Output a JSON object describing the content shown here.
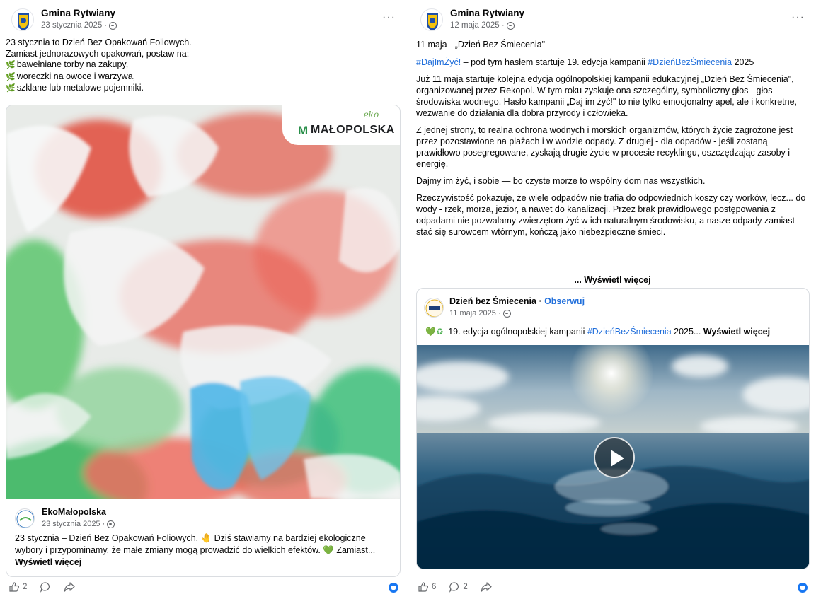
{
  "left_post": {
    "page_name": "Gmina Rytwiany",
    "date": "23 stycznia 2025 ·",
    "more": "···",
    "lines": [
      "23 stycznia to Dzień Bez Opakowań Foliowych.",
      "Zamiast jednorazowych opakowań, postaw na:"
    ],
    "bullets": [
      "bawełniane torby na zakupy,",
      "woreczki na owoce i warzywa,",
      "szklane lub metalowe pojemniki."
    ],
    "image_logo": {
      "eko": "– eko –",
      "brand": "MAŁOPOLSKA"
    },
    "shared": {
      "author": "EkoMałopolska",
      "date": "23 stycznia 2025 ·",
      "text": "23 stycznia – Dzień Bez Opakowań Foliowych. 🤚 Dziś stawiamy na bardziej ekologiczne wybory i przypominamy, że małe zmiany mogą prowadzić do wielkich efektów. 💚 Zamiast...",
      "see_more": "Wyświetl więcej"
    },
    "actions": {
      "likes": "2"
    }
  },
  "right_post": {
    "page_name": "Gmina Rytwiany",
    "date": "12 maja 2025 ·",
    "more": "···",
    "intro": "11 maja - „Dzień Bez Śmiecenia\"",
    "hashtag_line": {
      "tag1": "#DajImŻyć!",
      "middle": " – pod tym hasłem startuje 19. edycja kampanii ",
      "tag2": "#DzieńBezŚmiecenia",
      "end": " 2025"
    },
    "paragraphs": [
      "Już 11 maja startuje kolejna edycja ogólnopolskiej kampanii edukacyjnej „Dzień Bez Śmiecenia\", organizowanej przez Rekopol. W tym roku zyskuje ona szczególny, symboliczny głos - głos środowiska wodnego. Hasło kampanii „Daj im żyć!\" to nie tylko emocjonalny apel, ale i konkretne, wezwanie do działania dla dobra przyrody i człowieka.",
      "Z jednej strony, to realna ochrona wodnych i morskich organizmów, których życie zagrożone jest przez pozostawione na plażach i w wodzie odpady. Z drugiej - dla odpadów - jeśli zostaną prawidłowo posegregowane, zyskają drugie życie w procesie recyklingu, oszczędzając zasoby i energię.",
      "Dajmy im żyć, i sobie — bo czyste morze to wspólny dom nas wszystkich.",
      "Rzeczywistość pokazuje, że wiele odpadów nie trafia do odpowiednich koszy czy worków, lecz... do wody - rzek, morza, jezior, a nawet do kanalizacji. Przez brak prawidłowego postępowania z odpadami nie pozwalamy zwierzętom żyć w ich naturalnym środowisku, a nasze odpady zamiast stać się surowcem wtórnym, kończą jako niebezpieczne śmieci."
    ],
    "see_more": "... Wyświetl więcej",
    "shared": {
      "author": "Dzień bez Śmiecenia",
      "separator": " · ",
      "follow": "Obserwuj",
      "date": "11 maja 2025 ·",
      "text_start": " 19. edycja ogólnopolskiej kampanii ",
      "hashtag": "#DzieńBezŚmiecenia",
      "text_end": " 2025... ",
      "see_more": "Wyświetl więcej"
    },
    "actions": {
      "likes": "6",
      "comments": "2"
    }
  },
  "colors": {
    "link_blue": "#216fdb",
    "like_blue": "#1877f2",
    "meta_gray": "#65676b"
  }
}
